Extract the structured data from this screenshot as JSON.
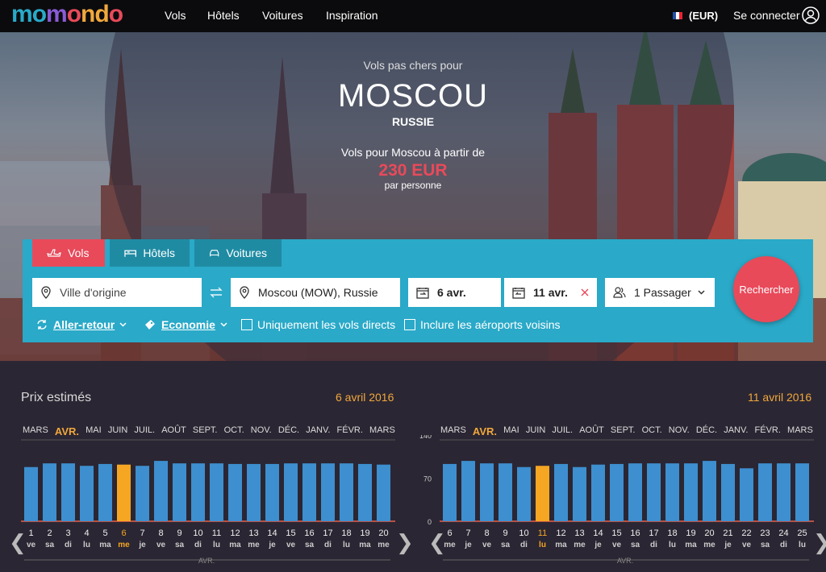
{
  "logo": "momondo",
  "logo_colors": [
    "#2aa9c8",
    "#2aa9c8",
    "#8a5bd6",
    "#e84a5a",
    "#f0a83c",
    "#f0a83c",
    "#e84a5a"
  ],
  "nav": [
    "Vols",
    "Hôtels",
    "Voitures",
    "Inspiration"
  ],
  "currency": "(EUR)",
  "login": "Se connecter",
  "hero": {
    "subtitle": "Vols pas chers pour",
    "city": "MOSCOU",
    "country": "RUSSIE",
    "from_text": "Vols pour Moscou à partir de",
    "price": "230 EUR",
    "per_person": "par personne"
  },
  "tabs": [
    "Vols",
    "Hôtels",
    "Voitures"
  ],
  "form": {
    "origin_placeholder": "Ville d'origine",
    "destination": "Moscou (MOW), Russie",
    "depart": "6 avr.",
    "return": "11 avr.",
    "passengers": "1 Passager",
    "trip_type": "Aller-retour",
    "cabin": "Economie",
    "direct_only": "Uniquement les vols directs",
    "nearby": "Inclure les aéroports voisins",
    "search": "Rechercher"
  },
  "calendar": {
    "title": "Prix estimés",
    "months": [
      "MARS",
      "AVR.",
      "MAI",
      "JUIN",
      "JUIL.",
      "AOÛT",
      "SEPT.",
      "OCT.",
      "NOV.",
      "DÉC.",
      "JANV.",
      "FÉVR.",
      "MARS"
    ],
    "active_month_index": 1,
    "axis_label": "AVR.",
    "colors": {
      "bar": "#3d8fcf",
      "selected": "#f5a623",
      "accent": "#f0a83c"
    }
  },
  "chart_data": [
    {
      "type": "bar",
      "title": "6 avril 2016",
      "categories": [
        "1 ve",
        "2 sa",
        "3 di",
        "4 lu",
        "5 ma",
        "6 me",
        "7 je",
        "8 ve",
        "9 sa",
        "10 di",
        "11 lu",
        "12 ma",
        "13 me",
        "14 je",
        "15 ve",
        "16 sa",
        "17 di",
        "18 lu",
        "19 ma",
        "20 me"
      ],
      "days": [
        "1",
        "2",
        "3",
        "4",
        "5",
        "6",
        "7",
        "8",
        "9",
        "10",
        "11",
        "12",
        "13",
        "14",
        "15",
        "16",
        "17",
        "18",
        "19",
        "20"
      ],
      "weekdays": [
        "ve",
        "sa",
        "di",
        "lu",
        "ma",
        "me",
        "je",
        "ve",
        "sa",
        "di",
        "lu",
        "ma",
        "me",
        "je",
        "ve",
        "sa",
        "di",
        "lu",
        "ma",
        "me"
      ],
      "values": [
        88,
        94,
        94,
        90,
        93,
        92,
        90,
        98,
        94,
        94,
        94,
        93,
        93,
        93,
        94,
        94,
        94,
        94,
        93,
        92
      ],
      "selected_index": 5,
      "ylim": [
        0,
        140
      ]
    },
    {
      "type": "bar",
      "title": "11 avril 2016",
      "categories": [
        "6 me",
        "7 je",
        "8 ve",
        "9 sa",
        "10 di",
        "11 lu",
        "12 ma",
        "13 me",
        "14 je",
        "15 ve",
        "16 sa",
        "17 di",
        "18 lu",
        "19 ma",
        "20 me",
        "21 je",
        "22 ve",
        "23 sa",
        "24 di",
        "25 lu"
      ],
      "days": [
        "6",
        "7",
        "8",
        "9",
        "10",
        "11",
        "12",
        "13",
        "14",
        "15",
        "16",
        "17",
        "18",
        "19",
        "20",
        "21",
        "22",
        "23",
        "24",
        "25"
      ],
      "weekdays": [
        "me",
        "je",
        "ve",
        "sa",
        "di",
        "lu",
        "ma",
        "me",
        "je",
        "ve",
        "sa",
        "di",
        "lu",
        "ma",
        "me",
        "je",
        "ve",
        "sa",
        "di",
        "lu"
      ],
      "values": [
        93,
        98,
        94,
        94,
        88,
        90,
        93,
        88,
        92,
        93,
        94,
        94,
        94,
        94,
        98,
        93,
        86,
        94,
        94,
        94
      ],
      "selected_index": 5,
      "ylim": [
        0,
        140
      ],
      "yticks": [
        0,
        70,
        140
      ]
    }
  ]
}
